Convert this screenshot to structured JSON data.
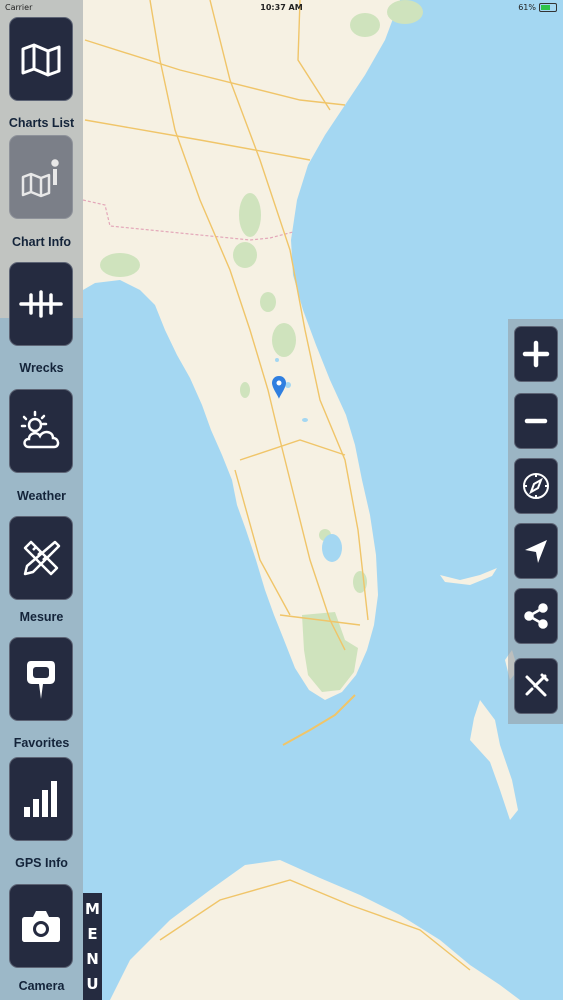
{
  "status_bar": {
    "carrier": "Carrier",
    "time": "10:37 AM",
    "battery": "61%",
    "battery_level": 0.61
  },
  "sidebar": {
    "items": [
      {
        "label": "Charts List",
        "icon": "folded-map-icon"
      },
      {
        "label": "Chart Info",
        "icon": "map-info-icon"
      },
      {
        "label": "Wrecks",
        "icon": "wreck-symbol-icon"
      },
      {
        "label": "Weather",
        "icon": "sun-cloud-icon"
      },
      {
        "label": "Mesure",
        "icon": "ruler-pencil-icon"
      },
      {
        "label": "Favorites",
        "icon": "map-pin-icon"
      },
      {
        "label": "GPS Info",
        "icon": "signal-bars-icon"
      },
      {
        "label": "Camera",
        "icon": "camera-icon"
      }
    ]
  },
  "menu_tab": {
    "letters": [
      "M",
      "E",
      "N",
      "U"
    ]
  },
  "map_controls": [
    {
      "name": "zoom-in",
      "icon": "plus-icon"
    },
    {
      "name": "zoom-out",
      "icon": "minus-icon"
    },
    {
      "name": "compass",
      "icon": "compass-icon"
    },
    {
      "name": "locate",
      "icon": "location-arrow-icon"
    },
    {
      "name": "share",
      "icon": "share-icon"
    },
    {
      "name": "settings",
      "icon": "tools-icon"
    }
  ],
  "colors": {
    "water": "#a4d7f2",
    "land": "#f6f1e3",
    "button": "#252b40",
    "pin": "#2f7fe0"
  }
}
